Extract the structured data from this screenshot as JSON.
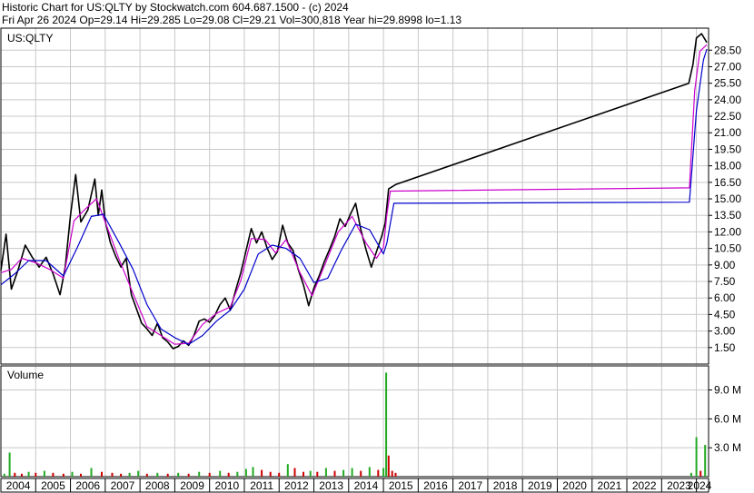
{
  "header": {
    "line1": "Historic Chart for US:QLTY by Stockwatch.com 604.687.1500 - (c) 2024",
    "line2": "Fri Apr 26 2024   Op=29.14  Hi=29.285  Lo=29.08  Cl=29.21  Vol=300,818  Year hi=29.8998  lo=1.13"
  },
  "price_panel": {
    "symbol": "US:QLTY"
  },
  "volume_panel": {
    "label": "Volume"
  },
  "colors": {
    "price": "#000000",
    "ma_short": "#cc00cc",
    "ma_long": "#0000cc",
    "vol_up": "#22aa22",
    "vol_down": "#cc0000",
    "grid": "#c8c8c8"
  },
  "chart_data": {
    "type": "line",
    "title": "Historic Chart for US:QLTY",
    "x_ticks": [
      "2004",
      "2005",
      "2006",
      "2007",
      "2008",
      "2009",
      "2010",
      "2011",
      "2012",
      "2013",
      "2014",
      "2015",
      "2016",
      "2017",
      "2018",
      "2019",
      "2020",
      "2021",
      "2022",
      "2023",
      "2024"
    ],
    "xlim": [
      2004.0,
      2024.35
    ],
    "y_ticks": [
      "1.50",
      "3.00",
      "4.50",
      "6.00",
      "7.50",
      "9.00",
      "10.50",
      "12.00",
      "13.50",
      "15.00",
      "16.50",
      "18.00",
      "19.50",
      "21.00",
      "22.50",
      "24.00",
      "25.50",
      "27.00",
      "28.50"
    ],
    "ylim": [
      0.0,
      30.5
    ],
    "vol_ticks": [
      "3.0 M",
      "6.0 M",
      "9.0 M"
    ],
    "vol_ylim": [
      0,
      11500000
    ],
    "series": [
      {
        "name": "price",
        "points": [
          [
            2004.0,
            8.5
          ],
          [
            2004.15,
            11.8
          ],
          [
            2004.3,
            6.8
          ],
          [
            2004.5,
            8.6
          ],
          [
            2004.7,
            10.8
          ],
          [
            2004.9,
            9.7
          ],
          [
            2005.1,
            8.8
          ],
          [
            2005.3,
            9.7
          ],
          [
            2005.5,
            8.2
          ],
          [
            2005.7,
            6.3
          ],
          [
            2005.85,
            8.8
          ],
          [
            2006.0,
            13.5
          ],
          [
            2006.15,
            17.2
          ],
          [
            2006.3,
            12.9
          ],
          [
            2006.5,
            14.0
          ],
          [
            2006.7,
            16.8
          ],
          [
            2006.8,
            13.5
          ],
          [
            2006.9,
            15.8
          ],
          [
            2007.0,
            13.0
          ],
          [
            2007.15,
            11.0
          ],
          [
            2007.3,
            9.8
          ],
          [
            2007.45,
            8.8
          ],
          [
            2007.6,
            9.6
          ],
          [
            2007.75,
            6.3
          ],
          [
            2007.9,
            5.0
          ],
          [
            2008.05,
            3.7
          ],
          [
            2008.2,
            3.2
          ],
          [
            2008.35,
            2.6
          ],
          [
            2008.5,
            3.7
          ],
          [
            2008.65,
            2.4
          ],
          [
            2008.8,
            2.0
          ],
          [
            2008.95,
            1.4
          ],
          [
            2009.1,
            1.6
          ],
          [
            2009.25,
            2.1
          ],
          [
            2009.4,
            1.7
          ],
          [
            2009.55,
            2.6
          ],
          [
            2009.7,
            3.9
          ],
          [
            2009.85,
            4.1
          ],
          [
            2010.0,
            3.8
          ],
          [
            2010.15,
            4.4
          ],
          [
            2010.3,
            5.4
          ],
          [
            2010.45,
            6.0
          ],
          [
            2010.6,
            4.9
          ],
          [
            2010.75,
            6.7
          ],
          [
            2010.9,
            8.3
          ],
          [
            2011.05,
            10.3
          ],
          [
            2011.2,
            12.3
          ],
          [
            2011.35,
            11.0
          ],
          [
            2011.5,
            12.0
          ],
          [
            2011.65,
            10.6
          ],
          [
            2011.8,
            9.5
          ],
          [
            2011.95,
            10.2
          ],
          [
            2012.1,
            12.6
          ],
          [
            2012.25,
            11.0
          ],
          [
            2012.4,
            10.3
          ],
          [
            2012.55,
            8.6
          ],
          [
            2012.7,
            7.2
          ],
          [
            2012.85,
            5.3
          ],
          [
            2013.0,
            6.9
          ],
          [
            2013.15,
            8.0
          ],
          [
            2013.3,
            9.3
          ],
          [
            2013.45,
            10.4
          ],
          [
            2013.6,
            11.6
          ],
          [
            2013.75,
            13.2
          ],
          [
            2013.9,
            12.5
          ],
          [
            2014.05,
            13.6
          ],
          [
            2014.2,
            14.6
          ],
          [
            2014.35,
            12.2
          ],
          [
            2014.5,
            10.4
          ],
          [
            2014.65,
            8.8
          ],
          [
            2014.8,
            10.2
          ],
          [
            2014.95,
            11.6
          ],
          [
            2015.05,
            12.8
          ],
          [
            2015.15,
            15.9
          ],
          [
            2015.35,
            16.3
          ],
          [
            2023.78,
            25.5
          ],
          [
            2023.9,
            27.2
          ],
          [
            2024.0,
            29.6
          ],
          [
            2024.15,
            30.0
          ],
          [
            2024.3,
            29.2
          ]
        ]
      },
      {
        "name": "ma_short",
        "points": [
          [
            2004.0,
            8.3
          ],
          [
            2004.3,
            8.6
          ],
          [
            2004.6,
            9.6
          ],
          [
            2005.0,
            9.2
          ],
          [
            2005.4,
            8.6
          ],
          [
            2005.8,
            7.8
          ],
          [
            2006.1,
            13.0
          ],
          [
            2006.4,
            14.0
          ],
          [
            2006.75,
            15.0
          ],
          [
            2007.0,
            12.9
          ],
          [
            2007.4,
            9.5
          ],
          [
            2007.8,
            6.4
          ],
          [
            2008.2,
            3.4
          ],
          [
            2008.6,
            2.6
          ],
          [
            2009.0,
            1.8
          ],
          [
            2009.4,
            1.9
          ],
          [
            2009.8,
            3.6
          ],
          [
            2010.2,
            4.6
          ],
          [
            2010.6,
            5.2
          ],
          [
            2010.9,
            7.6
          ],
          [
            2011.2,
            11.4
          ],
          [
            2011.6,
            11.3
          ],
          [
            2011.9,
            10.1
          ],
          [
            2012.2,
            11.3
          ],
          [
            2012.6,
            8.3
          ],
          [
            2012.95,
            6.2
          ],
          [
            2013.3,
            8.9
          ],
          [
            2013.7,
            12.0
          ],
          [
            2014.1,
            13.4
          ],
          [
            2014.5,
            11.0
          ],
          [
            2014.8,
            9.6
          ],
          [
            2015.0,
            10.6
          ],
          [
            2015.1,
            13.6
          ],
          [
            2015.2,
            15.7
          ],
          [
            2023.8,
            16.0
          ],
          [
            2023.95,
            24.8
          ],
          [
            2024.1,
            28.4
          ],
          [
            2024.3,
            29.0
          ]
        ]
      },
      {
        "name": "ma_long",
        "points": [
          [
            2004.0,
            7.2
          ],
          [
            2004.4,
            8.2
          ],
          [
            2004.8,
            9.4
          ],
          [
            2005.3,
            9.4
          ],
          [
            2005.8,
            8.0
          ],
          [
            2006.2,
            10.6
          ],
          [
            2006.6,
            13.4
          ],
          [
            2006.95,
            13.6
          ],
          [
            2007.4,
            11.0
          ],
          [
            2007.8,
            8.6
          ],
          [
            2008.2,
            5.4
          ],
          [
            2008.6,
            3.2
          ],
          [
            2009.0,
            2.4
          ],
          [
            2009.4,
            1.8
          ],
          [
            2009.8,
            2.6
          ],
          [
            2010.2,
            3.9
          ],
          [
            2010.6,
            4.9
          ],
          [
            2011.0,
            6.8
          ],
          [
            2011.4,
            10.0
          ],
          [
            2011.8,
            10.8
          ],
          [
            2012.2,
            10.5
          ],
          [
            2012.6,
            9.6
          ],
          [
            2013.0,
            7.4
          ],
          [
            2013.4,
            7.8
          ],
          [
            2013.8,
            10.4
          ],
          [
            2014.2,
            12.7
          ],
          [
            2014.6,
            12.2
          ],
          [
            2015.0,
            10.0
          ],
          [
            2015.1,
            11.0
          ],
          [
            2015.3,
            14.6
          ],
          [
            2023.8,
            14.7
          ],
          [
            2024.0,
            23.0
          ],
          [
            2024.2,
            27.6
          ],
          [
            2024.3,
            28.6
          ]
        ]
      }
    ],
    "volume_bars": [
      [
        2004.1,
        0.3
      ],
      [
        2004.25,
        2.5
      ],
      [
        2004.4,
        0.4
      ],
      [
        2004.6,
        0.3
      ],
      [
        2004.8,
        0.5
      ],
      [
        2005.0,
        0.4
      ],
      [
        2005.25,
        0.6
      ],
      [
        2005.5,
        0.4
      ],
      [
        2005.8,
        0.3
      ],
      [
        2006.05,
        0.5
      ],
      [
        2006.3,
        0.3
      ],
      [
        2006.6,
        0.9
      ],
      [
        2006.9,
        0.5
      ],
      [
        2007.2,
        0.4
      ],
      [
        2007.45,
        0.3
      ],
      [
        2007.7,
        0.4
      ],
      [
        2007.95,
        0.6
      ],
      [
        2008.2,
        0.3
      ],
      [
        2008.5,
        0.4
      ],
      [
        2008.8,
        0.3
      ],
      [
        2009.1,
        0.4
      ],
      [
        2009.4,
        0.3
      ],
      [
        2009.7,
        0.5
      ],
      [
        2010.0,
        0.4
      ],
      [
        2010.3,
        0.6
      ],
      [
        2010.55,
        0.4
      ],
      [
        2010.8,
        0.5
      ],
      [
        2011.05,
        0.8
      ],
      [
        2011.25,
        1.0
      ],
      [
        2011.5,
        0.7
      ],
      [
        2011.75,
        0.5
      ],
      [
        2012.0,
        0.4
      ],
      [
        2012.25,
        1.3
      ],
      [
        2012.45,
        0.9
      ],
      [
        2012.7,
        0.5
      ],
      [
        2012.9,
        0.6
      ],
      [
        2013.1,
        0.5
      ],
      [
        2013.35,
        0.9
      ],
      [
        2013.6,
        0.6
      ],
      [
        2013.85,
        0.7
      ],
      [
        2014.1,
        0.9
      ],
      [
        2014.35,
        0.6
      ],
      [
        2014.6,
        1.0
      ],
      [
        2014.85,
        0.7
      ],
      [
        2015.0,
        0.9
      ],
      [
        2015.08,
        10.8
      ],
      [
        2015.15,
        2.2
      ],
      [
        2015.25,
        0.6
      ],
      [
        2015.35,
        0.4
      ],
      [
        2023.85,
        0.4
      ],
      [
        2024.0,
        4.1
      ],
      [
        2024.12,
        0.6
      ],
      [
        2024.25,
        3.3
      ]
    ]
  }
}
